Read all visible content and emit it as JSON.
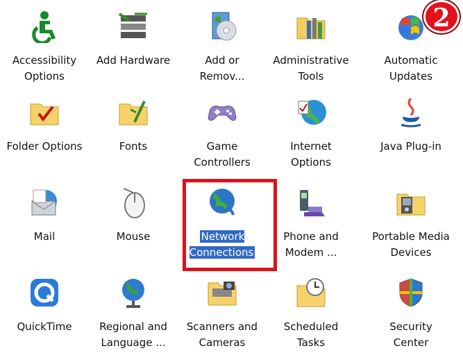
{
  "badge": {
    "text": "2",
    "color": "#e3111b"
  },
  "highlight_color": "#e0101a",
  "selection_color": "#316ac5",
  "items": [
    {
      "label": "Accessibility\nOptions",
      "icon": "accessibility-icon"
    },
    {
      "label": "Add Hardware",
      "icon": "add-hardware-icon"
    },
    {
      "label": "Add or\nRemov...",
      "icon": "add-remove-programs-icon"
    },
    {
      "label": "Administrative\nTools",
      "icon": "administrative-tools-icon"
    },
    {
      "label": "Automatic\nUpdates",
      "icon": "automatic-updates-icon"
    },
    {
      "label": "Folder Options",
      "icon": "folder-options-icon"
    },
    {
      "label": "Fonts",
      "icon": "fonts-folder-icon"
    },
    {
      "label": "Game\nControllers",
      "icon": "game-controller-icon"
    },
    {
      "label": "Internet\nOptions",
      "icon": "internet-options-icon"
    },
    {
      "label": "Java Plug-in",
      "icon": "java-icon"
    },
    {
      "label": "Mail",
      "icon": "mail-icon"
    },
    {
      "label": "Mouse",
      "icon": "mouse-icon"
    },
    {
      "label": "Network\nConnections",
      "icon": "network-connections-icon",
      "selected": true
    },
    {
      "label": "Phone and\nModem ...",
      "icon": "phone-modem-icon"
    },
    {
      "label": "Portable Media\nDevices",
      "icon": "portable-media-icon"
    },
    {
      "label": "QuickTime",
      "icon": "quicktime-icon"
    },
    {
      "label": "Regional and\nLanguage ...",
      "icon": "regional-globe-icon"
    },
    {
      "label": "Scanners and\nCameras",
      "icon": "scanner-camera-icon"
    },
    {
      "label": "Scheduled\nTasks",
      "icon": "scheduled-tasks-icon"
    },
    {
      "label": "Security\nCenter",
      "icon": "security-shield-icon"
    }
  ]
}
